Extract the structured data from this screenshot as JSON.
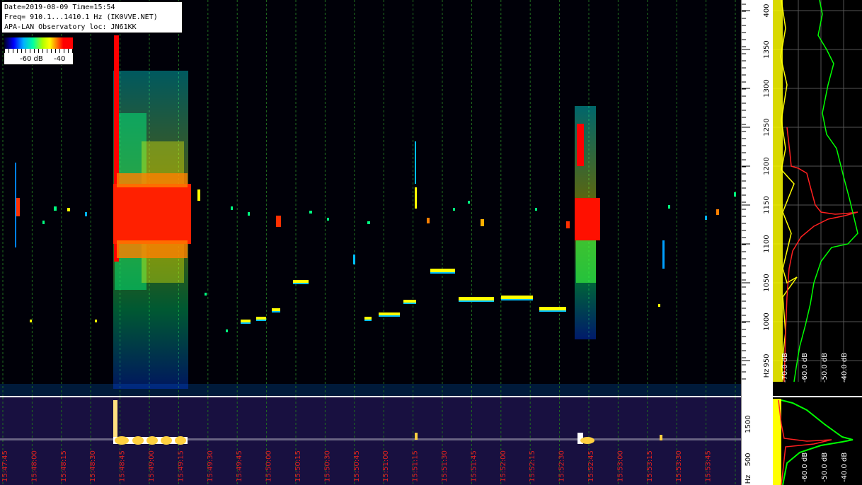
{
  "header": {
    "line1": "Date=2019-08-09 Time=15:54",
    "line2": "Freq= 910.1...1410.1 Hz (IK0VVE.NET)",
    "line3": "APA-LAN Observatory loc: JN61KK"
  },
  "colorbar": {
    "label_low": "-60 dB",
    "label_high": "-40"
  },
  "freq_ticks": [
    "400",
    "1350",
    "1300",
    "1250",
    "1200",
    "1150",
    "1100",
    "1050",
    "1000",
    "950"
  ],
  "freq_unit": "Hz",
  "spectrum_db_labels": [
    "-70.0 dB",
    "-60.0 dB",
    "-50.0 dB",
    "-40.0 dB"
  ],
  "lower_freq_ticks": [
    "1500",
    "500"
  ],
  "lower_freq_unit": "Hz",
  "lower_db_labels": [
    "-60.0 dB",
    "-50.0 dB",
    "-40.0 dB"
  ],
  "time_labels": [
    "15:47:45",
    "15:48:00",
    "15:48:15",
    "15:48:30",
    "15:48:45",
    "15:49:00",
    "15:49:15",
    "15:49:30",
    "15:49:45",
    "15:50:00",
    "15:50:15",
    "15:50:30",
    "15:50:45",
    "15:51:00",
    "15:51:15",
    "15:51:30",
    "15:51:45",
    "15:52:00",
    "15:52:15",
    "15:52:30",
    "15:52:45",
    "15:53:00",
    "15:53:15",
    "15:53:30",
    "15:53:45"
  ],
  "colors": {
    "grid": "#1f6e1f",
    "time_label": "#e02020",
    "spectrum_avg": "#00ff00",
    "spectrum_cur": "#ff2020",
    "spectrum_peak": "#ffff00"
  }
}
